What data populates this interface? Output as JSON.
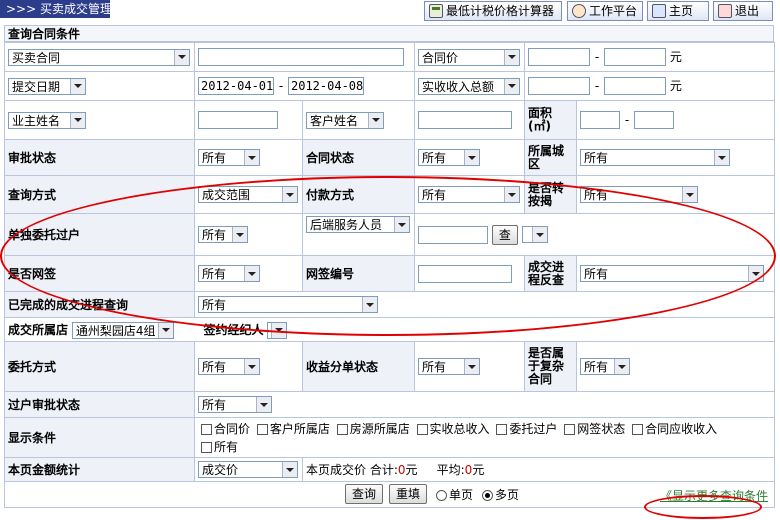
{
  "header": {
    "tab_arrow": ">>>",
    "tab_title": "买卖成交管理",
    "btn_calc": "最低计税价格计算器",
    "btn_workbench": "工作平台",
    "btn_home": "主页",
    "btn_exit": "退出"
  },
  "section_title": "查询合同条件",
  "row1": {
    "contract_type": "买卖合同",
    "text_value": "",
    "price_select": "合同价",
    "from": "",
    "to": "",
    "unit": "元"
  },
  "row2": {
    "date_select": "提交日期",
    "date_from": "2012-04-01",
    "date_to": "2012-04-08",
    "income_select": "实收收入总额",
    "from": "",
    "to": "",
    "unit": "元"
  },
  "row3": {
    "owner_select": "业主姓名",
    "owner_value": "",
    "customer_select": "客户姓名",
    "customer_value": "",
    "area_label": "面积",
    "area_unit": "(㎡)",
    "area_from": "",
    "area_to": ""
  },
  "row4": {
    "approval_label": "审批状态",
    "approval_value": "所有",
    "contract_status_label": "合同状态",
    "contract_status_value": "所有",
    "city_label": "所属城区",
    "city_value": "所有"
  },
  "row5": {
    "query_label": "查询方式",
    "query_value": "成交范围",
    "payment_label": "付款方式",
    "payment_value": "所有",
    "loan_label": "是否转按揭",
    "loan_value": "所有"
  },
  "row6": {
    "entrust_label": "单独委托过户",
    "entrust_value": "所有",
    "service_select": "后端服务人员",
    "service_value": "",
    "search_btn": "查"
  },
  "row7": {
    "netsign_label": "是否网签",
    "netsign_value": "所有",
    "netsign_no_label": "网签编号",
    "netsign_no_value": "",
    "progress_label": "成交进程反查",
    "progress_value": "所有"
  },
  "row8": {
    "completed_label": "已完成的成交进程查询",
    "completed_value": "所有"
  },
  "row9": {
    "store_label": "成交所属店",
    "store_value": "通州梨园店4组",
    "agent_label": "签约经纪人"
  },
  "row10": {
    "entrust_way_label": "委托方式",
    "entrust_way_value": "所有",
    "revenue_label": "收益分单状态",
    "revenue_value": "所有",
    "complex_label": "是否属于复杂合同",
    "complex_value": "所有"
  },
  "row11": {
    "transfer_label": "过户审批状态",
    "transfer_value": "所有"
  },
  "row12": {
    "display_label": "显示条件",
    "options": [
      "合同价",
      "客户所属店",
      "房源所属店",
      "实收总收入",
      "委托过户",
      "网签状态",
      "合同应收收入",
      "所有"
    ]
  },
  "row13": {
    "total_label": "本页金额统计",
    "total_select": "成交价",
    "summary_text": "本页成交价",
    "sum_label": "合计:",
    "sum_value": "0",
    "avg_label": "平均:",
    "avg_value": "0",
    "unit": "元"
  },
  "footer": {
    "query_btn": "查询",
    "reset_btn": "重填",
    "radio_single": "单页",
    "radio_multi": "多页",
    "more_link": "《显示更多查询条件"
  }
}
